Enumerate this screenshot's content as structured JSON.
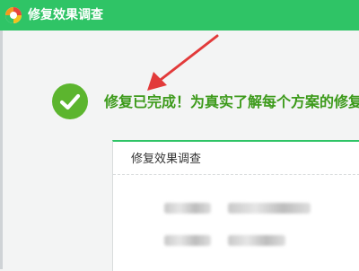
{
  "window": {
    "title": "修复效果调查"
  },
  "main": {
    "headline": "修复已完成！为真实了解每个方案的修复",
    "status_icon": "check-circle-icon",
    "annotation_icon": "red-arrow-icon"
  },
  "survey_panel": {
    "title": "修复效果调查"
  },
  "colors": {
    "titlebar": "#2fc466",
    "success": "#5cb52e",
    "headline": "#3c9a1a",
    "annotation": "#e23a3a"
  }
}
